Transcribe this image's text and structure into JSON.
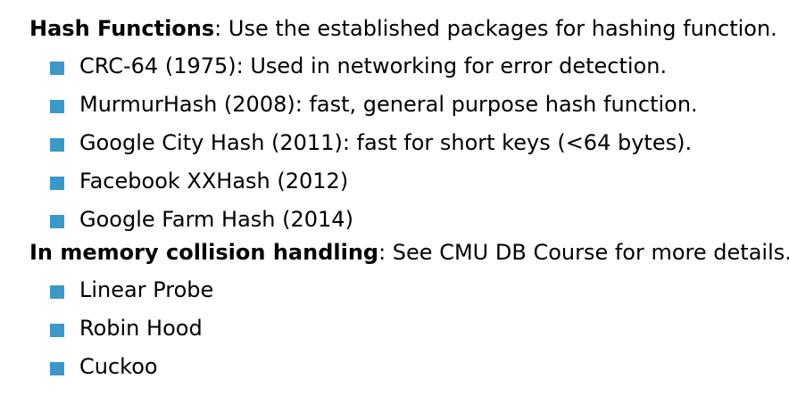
{
  "sections": [
    {
      "term": "Hash Functions",
      "description": ": Use the established packages for hashing function.",
      "items": [
        "CRC-64 (1975): Used in networking for error detection.",
        "MurmurHash (2008): fast, general purpose hash function.",
        "Google City Hash (2011): fast for short keys (<64 bytes).",
        "Facebook XXHash (2012)",
        "Google Farm Hash (2014)"
      ]
    },
    {
      "term": "In memory collision handling",
      "description": ": See CMU DB Course for more details.",
      "items": [
        "Linear Probe",
        "Robin Hood",
        "Cuckoo"
      ]
    }
  ],
  "colors": {
    "bullet": "#3b98c8",
    "text": "#000000"
  }
}
